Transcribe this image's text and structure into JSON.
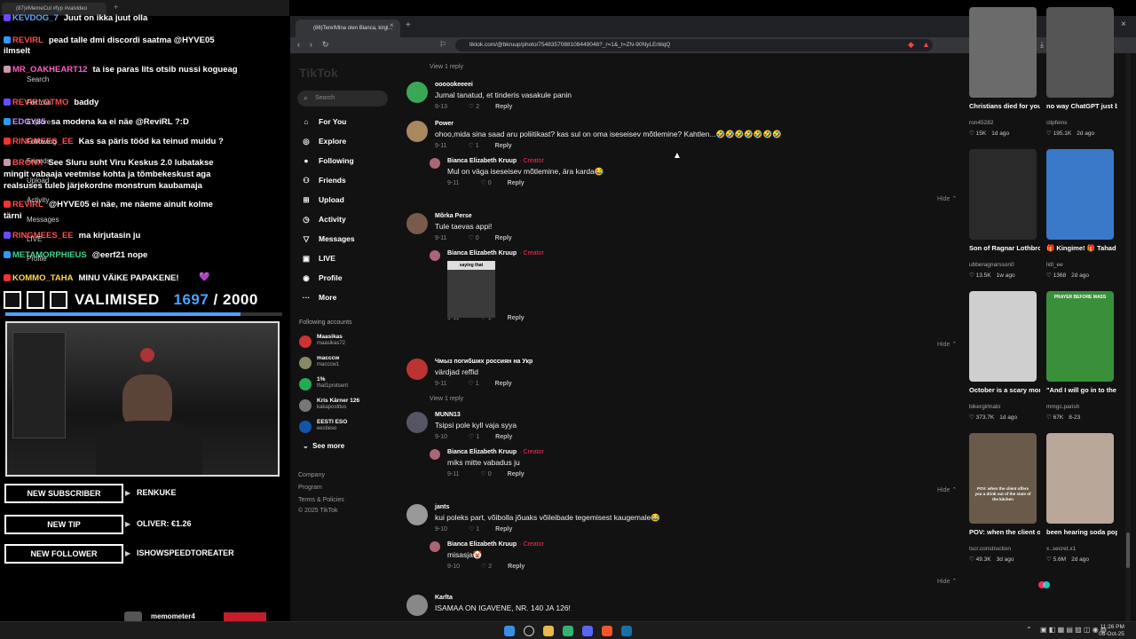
{
  "stream": {
    "tab_title": "(87)#MemeCut #fyp #valvideo",
    "chat": [
      {
        "user": "KEVDOG_7",
        "color": "#5fa8ff",
        "msg": "Juut on ikka juut olla"
      },
      {
        "user": "REVIRL",
        "color": "#ff4d4d",
        "msg": "pead talle dmi discordi saatma @HYVE05"
      },
      {
        "user": "",
        "color": "#fff",
        "msg": "ilmselt"
      },
      {
        "user": "MR_OAKHEART12",
        "color": "#ff5cc8",
        "msg": "ta ise paras lits otsib nussi kogueag"
      },
      {
        "user": "REVIRLOTMO",
        "color": "#ff4d4d",
        "msg": "baddy"
      },
      {
        "user": "EDGY85",
        "color": "#c18cff",
        "msg": "sa modena ka ei näe @ReviRL ?:D"
      },
      {
        "user": "RINGMEES_EE",
        "color": "#ff4d4d",
        "msg": "Kas sa päris tööd ka teinud muidu ?"
      },
      {
        "user": "BRONX",
        "color": "#ff4d4d",
        "msg": "See Sluru suht Viru Keskus 2.0 lubatakse"
      },
      {
        "user": "",
        "color": "#fff",
        "msg": "mingit vabaaja veetmise kohta ja tõmbekeskust aga"
      },
      {
        "user": "",
        "color": "#fff",
        "msg": "realsuses tuleb järjekordne monstrum kaubamaja"
      },
      {
        "user": "REVIRL",
        "color": "#ff4d4d",
        "msg": "@HYVE05 ei näe, me näeme ainult kolme"
      },
      {
        "user": "",
        "color": "#fff",
        "msg": "tärni"
      },
      {
        "user": "RINGMEES_EE",
        "color": "#ff4d4d",
        "msg": "ma kirjutasin ju"
      },
      {
        "user": "METAMORPHIEUS",
        "color": "#3dd68c",
        "msg": "@eerf21 nope"
      },
      {
        "user": "KOMMO_TAHA",
        "color": "#ffd84d",
        "msg": "MINU VÄIKE PAPAKENE!"
      }
    ],
    "overlay_tiktok_nav": [
      "Search",
      "For You",
      "Explore",
      "Following",
      "Friends",
      "Upload",
      "Activity",
      "Messages",
      "LIVE",
      "Profile"
    ],
    "goal_label": "VALIMISED",
    "goal_current": "1697",
    "goal_sep": "/",
    "goal_total": "2000",
    "goal_fraction": 0.8485,
    "alerts": [
      {
        "label": "NEW SUBSCRIBER",
        "value": "RENKUKE"
      },
      {
        "label": "NEW TIP",
        "value": "OLIVER: €1.26"
      },
      {
        "label": "NEW FOLLOWER",
        "value": "ISHOWSPEEDTOREATER"
      }
    ],
    "bottom_user": "memometer4"
  },
  "browser": {
    "tab_title": "(86)Tere!Mina olen Bianca, kirgl...",
    "url": "tiktok.com/@bkruup/photo/7548357088108449046?_r=1&_t=ZN-90NyLErblqQ"
  },
  "tiktok": {
    "logo": "TikTok",
    "search_placeholder": "Search",
    "nav": [
      {
        "label": "For You",
        "icon": "⌂"
      },
      {
        "label": "Explore",
        "icon": "◎"
      },
      {
        "label": "Following",
        "icon": "●"
      },
      {
        "label": "Friends",
        "icon": "⚇"
      },
      {
        "label": "Upload",
        "icon": "⊞"
      },
      {
        "label": "Activity",
        "icon": "◷"
      },
      {
        "label": "Messages",
        "icon": "▽"
      },
      {
        "label": "LIVE",
        "icon": "▣"
      },
      {
        "label": "Profile",
        "icon": "◉"
      },
      {
        "label": "More",
        "icon": "···"
      }
    ],
    "following_title": "Following accounts",
    "following": [
      {
        "name": "Maasikas",
        "handle": "maasikas72"
      },
      {
        "name": "macccw",
        "handle": "macccw1"
      },
      {
        "name": "1%",
        "handle": "that1protsent"
      },
      {
        "name": "Kris Kärner 126",
        "handle": "kakapostitus"
      },
      {
        "name": "EESTI ESO",
        "handle": "eestieso"
      }
    ],
    "see_more": "See more",
    "footer": [
      "Company",
      "Program",
      "Terms & Policies",
      "© 2025 TikTok"
    ]
  },
  "comments": {
    "view_reply": "View 1 reply",
    "reply_label": "Reply",
    "hide_label": "Hide",
    "creator_label": "· Creator",
    "items": [
      {
        "author": "oooookeeeei",
        "text": "Jumal tanatud, et tinderis vasakule panin",
        "date": "9-13",
        "likes": "2"
      },
      {
        "author": "Power",
        "text": "ohoo,mida sina saad aru poliitikast? kas sul on oma iseseisev mõtlemine? Kahtlen...🤣🤣🤣🤣🤣🤣🤣",
        "date": "9-11",
        "likes": "1"
      },
      {
        "author": "Bianca Elizabeth Kruup",
        "text": "Mul on väga iseseisev mõtlemine, ära karda😂",
        "date": "9-11",
        "likes": "0"
      },
      {
        "author": "Mõrka Perse",
        "text": "Tule taevas appi!",
        "date": "9-11",
        "likes": "0"
      },
      {
        "author": "Bianca Elizabeth Kruup",
        "text": "",
        "date": "9-11",
        "likes": "1"
      },
      {
        "author": "Чмыз погибших россиян на Укр",
        "text": "värdjad reffid",
        "date": "9-11",
        "likes": "1"
      },
      {
        "author": "MUNN13",
        "text": "Tsipsi pole kyll vaja syya",
        "date": "9-10",
        "likes": "1"
      },
      {
        "author": "Bianca Elizabeth Kruup",
        "text": "miks mitte vabadus ju",
        "date": "9-11",
        "likes": "0"
      },
      {
        "author": "jants",
        "text": "kui poleks part, võibolla jõuaks võileibade tegemisest kaugemale😂",
        "date": "9-10",
        "likes": "1"
      },
      {
        "author": "Bianca Elizabeth Kruup",
        "text": "misasja🤡",
        "date": "9-10",
        "likes": "2"
      },
      {
        "author": "Karlta",
        "text": "ISAMAA ON IGAVENE, NR. 140 JA 126!",
        "date": "",
        "likes": ""
      }
    ],
    "image_caption": "saying that"
  },
  "videos": [
    {
      "title": "Christians died for you just for you to...",
      "channel": "ron45282",
      "views": "15K",
      "date": "1d ago"
    },
    {
      "title": "no way ChatGPT just blackmailed and...",
      "channel": "clipfeins",
      "views": "195.1K",
      "date": "2d ago"
    },
    {
      "title": "Son of Ragnar Lothbrok 👑 #fyp...",
      "channel": "ubberagnarsson0",
      "views": "13.5K",
      "date": "1w ago"
    },
    {
      "title": "🎁 Kingime! 🎁 Tahad jäädvustada...",
      "channel": "lidl_ee",
      "views": "1368",
      "date": "2d ago"
    },
    {
      "title": "October is a scary month 😳 ...",
      "channel": "bikergirlnabi",
      "views": "373.7K",
      "date": "1d ago"
    },
    {
      "title": "\"And I will go in to the altar of God: to...",
      "channel": "mmgc.parish",
      "views": "67K",
      "date": "8-23"
    },
    {
      "title": "POV: when the client offers you a drink...",
      "channel": "tscr.construction",
      "views": "49.3K",
      "date": "3d ago"
    },
    {
      "title": "been hearing soda pop non stop too...",
      "channel": "x..secret.x1",
      "views": "5.6M",
      "date": "2d ago"
    }
  ],
  "thumb_texts": {
    "prayer": "PRAYER BEFORE MASS",
    "pov": "POV: when the client offers you a drink out of the state of the kitchen"
  },
  "clock": {
    "time": "11:26 PM",
    "date": "08-Oct-25"
  }
}
